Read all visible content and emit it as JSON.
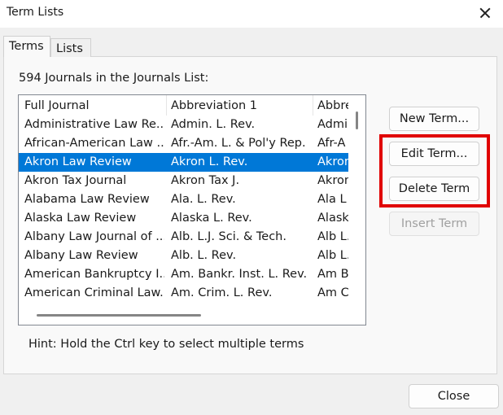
{
  "window": {
    "title": "Term Lists"
  },
  "tabs": [
    {
      "label": "Terms",
      "active": true
    },
    {
      "label": "Lists",
      "active": false
    }
  ],
  "count_label": "594 Journals in the Journals List:",
  "table": {
    "columns": [
      "Full Journal",
      "Abbreviation 1",
      "Abbre"
    ],
    "selected_index": 2,
    "rows": [
      [
        "Administrative Law Re...",
        "Admin. L. Rev.",
        "Admi"
      ],
      [
        "African-American Law ...",
        "Afr.-Am. L. & Pol'y Rep.",
        "Afr-A"
      ],
      [
        "Akron Law Review",
        "Akron L. Rev.",
        "Akron"
      ],
      [
        "Akron Tax Journal",
        "Akron Tax J.",
        "Akron"
      ],
      [
        "Alabama Law Review",
        "Ala. L. Rev.",
        "Ala L"
      ],
      [
        "Alaska Law Review",
        "Alaska L. Rev.",
        "Alask"
      ],
      [
        "Albany Law Journal of ...",
        "Alb. L.J. Sci. & Tech.",
        "Alb L."
      ],
      [
        "Albany Law Review",
        "Alb. L. Rev.",
        "Alb L."
      ],
      [
        "American Bankruptcy I...",
        "Am. Bankr. Inst. L. Rev.",
        "Am B"
      ],
      [
        "American Criminal Law...",
        "Am. Crim. L. Rev.",
        "Am C"
      ]
    ]
  },
  "buttons": {
    "new_term": "New Term...",
    "edit_term": "Edit Term...",
    "delete_term": "Delete Term",
    "insert_term": "Insert Term",
    "close": "Close"
  },
  "hint": "Hint: Hold the Ctrl key to select multiple terms",
  "colors": {
    "selection": "#0078d7",
    "highlight_annotation": "#e00000"
  }
}
